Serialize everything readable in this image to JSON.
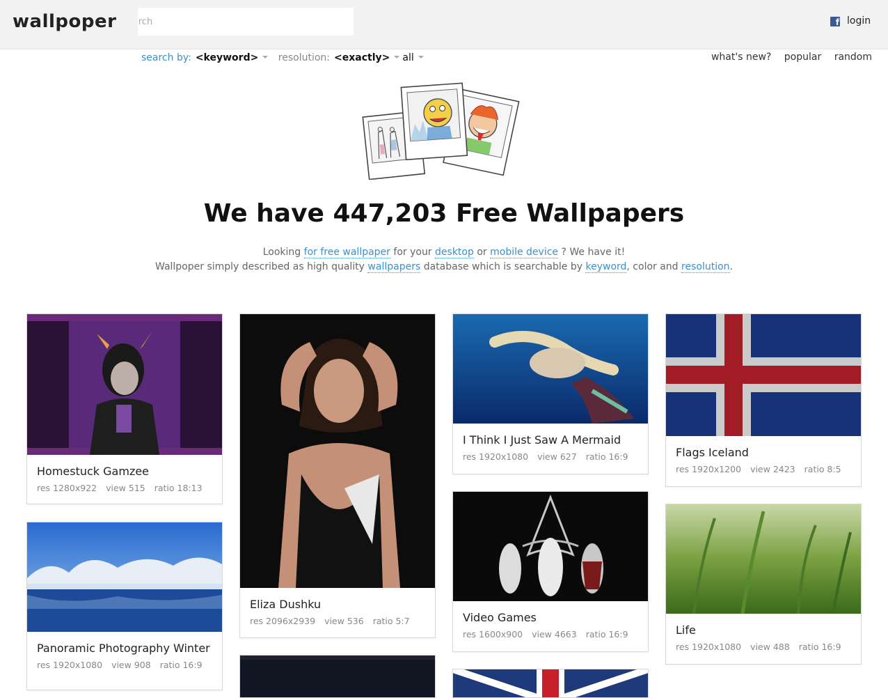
{
  "header": {
    "logo": "wallpoper",
    "search_placeholder": "search",
    "login_label": "login"
  },
  "filters": {
    "search_by_label": "search by:",
    "search_by_value": "<keyword>",
    "resolution_label": "resolution:",
    "resolution_mode": "<exactly>",
    "resolution_value": "all"
  },
  "topnav": [
    "what's new?",
    "popular",
    "random"
  ],
  "hero": {
    "headline": "We have 447,203 Free Wallpapers",
    "line1": {
      "t1": "Looking ",
      "l1": "for free wallpaper",
      "t2": " for your ",
      "l2": "desktop",
      "t3": " or ",
      "l3": "mobile device",
      "t4": " ? We have it!"
    },
    "line2": {
      "t1": "Wallpoper simply described as high quality ",
      "l1": "wallpapers",
      "t2": " database which is searchable by ",
      "l2": "keyword",
      "t3": ", color and ",
      "l3": "resolution",
      "t4": "."
    }
  },
  "cards": [
    {
      "title": "Homestuck Gamzee",
      "res": "res 1280x922",
      "view": "view 515",
      "ratio": "ratio 18:13"
    },
    {
      "title": "Panoramic Photography Winter",
      "res": "res 1920x1080",
      "view": "view 908",
      "ratio": "ratio 16:9"
    },
    {
      "title": "Eliza Dushku",
      "res": "res 2096x2939",
      "view": "view 536",
      "ratio": "ratio 5:7"
    },
    {
      "title": "I Think I Just Saw A Mermaid",
      "res": "res 1920x1080",
      "view": "view 627",
      "ratio": "ratio 16:9"
    },
    {
      "title": "Video Games",
      "res": "res 1600x900",
      "view": "view 4663",
      "ratio": "ratio 16:9"
    },
    {
      "title": "Flags Iceland",
      "res": "res 1920x1200",
      "view": "view 2423",
      "ratio": "ratio 8:5"
    },
    {
      "title": "Life",
      "res": "res 1920x1080",
      "view": "view 488",
      "ratio": "ratio 16:9"
    }
  ],
  "colors": {
    "link": "#3a8fd0",
    "header_bg": "#f2f2f2",
    "facebook": "#3b5998"
  },
  "icons": [
    "facebook-icon",
    "dropdown-caret-icon"
  ]
}
